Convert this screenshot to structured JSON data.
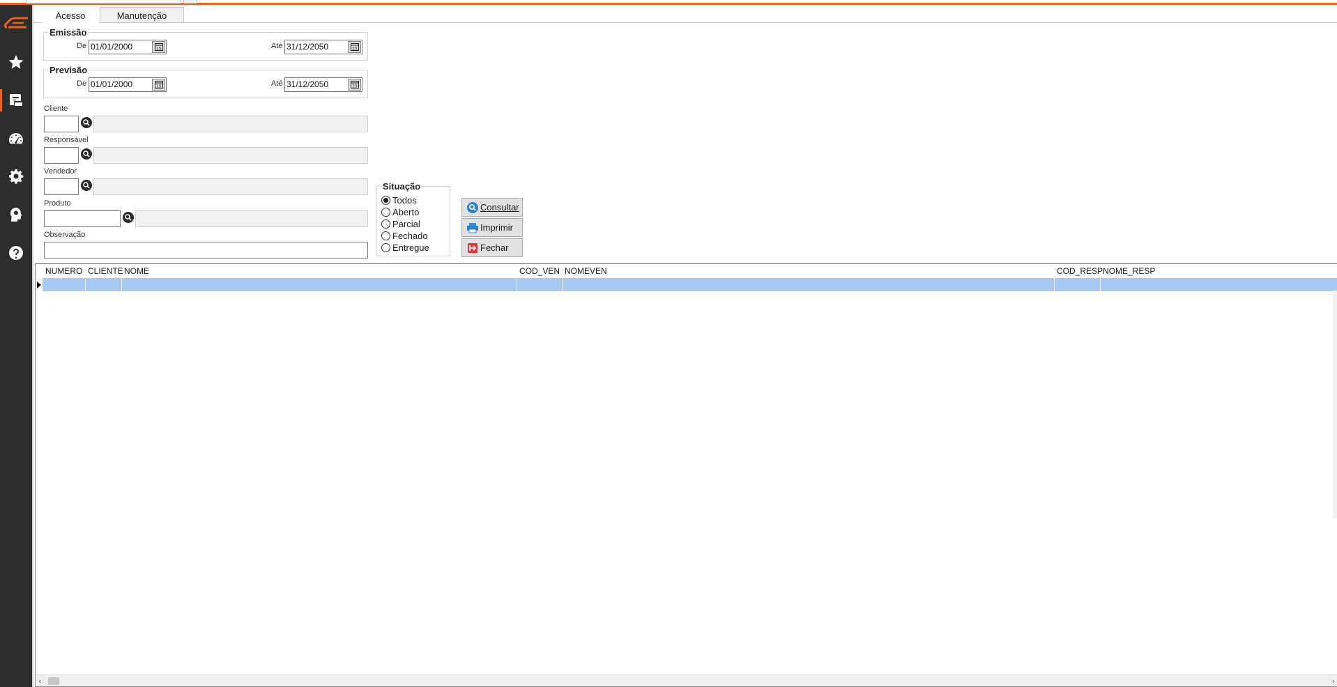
{
  "tabs": [
    {
      "label": "Acesso",
      "active": true
    },
    {
      "label": "Manutenção",
      "active": false
    }
  ],
  "sidebar": {
    "items": [
      {
        "icon": "star-icon"
      },
      {
        "icon": "document-icon",
        "active": true
      },
      {
        "icon": "dashboard-icon"
      },
      {
        "icon": "gear-icon"
      },
      {
        "icon": "support-icon"
      },
      {
        "icon": "help-icon"
      }
    ],
    "accent": "#e8631f"
  },
  "emissao": {
    "title": "Emissão",
    "de_label": "De",
    "de_value": "01/01/2000",
    "ate_label": "Até",
    "ate_value": "31/12/2050"
  },
  "previsao": {
    "title": "Previsão",
    "de_label": "De",
    "de_value": "01/01/2000",
    "ate_label": "Até",
    "ate_value": "31/12/2050"
  },
  "filters": {
    "cliente": "Cliente",
    "responsavel": "Responsável",
    "vendedor": "Vendedor",
    "produto": "Produto",
    "observacao": "Observação"
  },
  "situacao": {
    "title": "Situação",
    "options": [
      "Todos",
      "Aberto",
      "Parcial",
      "Fechado",
      "Entregue"
    ],
    "selected": "Todos"
  },
  "buttons": {
    "consultar": "Consultar",
    "imprimir": "Imprimir",
    "fechar": "Fechar"
  },
  "grid": {
    "columns": [
      "NUMERO",
      "CLIENTE",
      "NOME",
      "COD_VEN",
      "NOMEVEN",
      "COD_RESP",
      "NOME_RESP"
    ]
  }
}
